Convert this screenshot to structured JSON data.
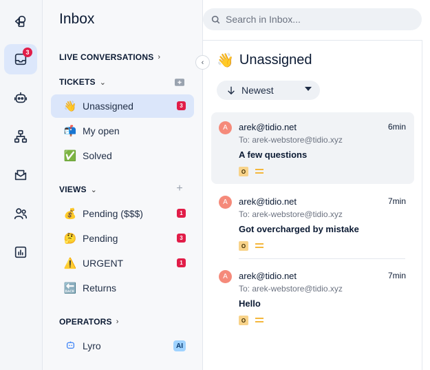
{
  "rail": {
    "inbox_badge": "3"
  },
  "panel": {
    "title": "Inbox",
    "live_conversations": "LIVE CONVERSATIONS",
    "tickets_header": "TICKETS",
    "tickets": [
      {
        "emoji": "👋",
        "label": "Unassigned",
        "badge": "3"
      },
      {
        "emoji": "📬",
        "label": "My open",
        "badge": ""
      },
      {
        "emoji": "✅",
        "label": "Solved",
        "badge": ""
      }
    ],
    "views_header": "VIEWS",
    "views": [
      {
        "emoji": "💰",
        "label": "Pending ($$$)",
        "badge": "1"
      },
      {
        "emoji": "🤔",
        "label": "Pending",
        "badge": "3"
      },
      {
        "emoji": "⚠️",
        "label": "URGENT",
        "badge": "1"
      },
      {
        "emoji": "🔙",
        "label": "Returns",
        "badge": ""
      }
    ],
    "operators_header": "OPERATORS",
    "operators": [
      {
        "label": "Lyro",
        "badge": "AI"
      }
    ]
  },
  "search": {
    "placeholder": "Search in Inbox..."
  },
  "main": {
    "emoji": "👋",
    "title": "Unassigned",
    "sort_label": "Newest",
    "tickets": [
      {
        "avatar": "A",
        "from": "arek@tidio.net",
        "time": "6min",
        "to": "To: arek-webstore@tidio.xyz",
        "subject": "A few questions",
        "tag": "O"
      },
      {
        "avatar": "A",
        "from": "arek@tidio.net",
        "time": "7min",
        "to": "To: arek-webstore@tidio.xyz",
        "subject": "Got overcharged by mistake",
        "tag": "O"
      },
      {
        "avatar": "A",
        "from": "arek@tidio.net",
        "time": "7min",
        "to": "To: arek-webstore@tidio.xyz",
        "subject": "Hello",
        "tag": "O"
      }
    ]
  },
  "colors": {
    "accent": "#dbe6fa",
    "badge": "#e11d48",
    "avatar": "#f58a7a",
    "priority": "#f4b73c"
  }
}
